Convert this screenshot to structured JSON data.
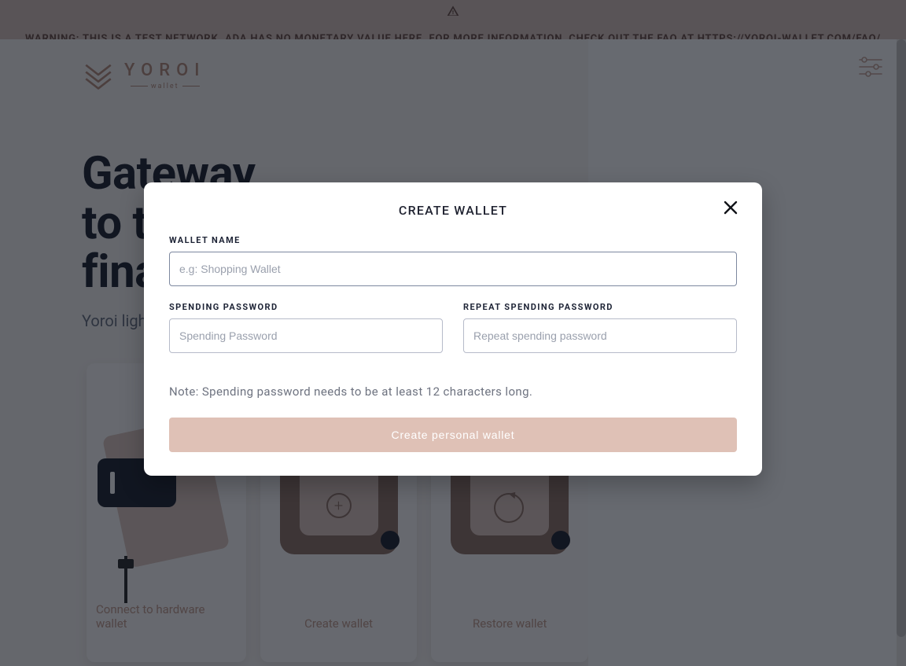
{
  "banner": {
    "text_prefix": "WARNING: THIS IS A TEST NETWORK. ADA HAS NO MONETARY VALUE HERE. FOR MORE INFORMATION, CHECK OUT THE FAQ AT ",
    "link_text": "HTTPS://YOROI-WALLET.COM/FAQ/"
  },
  "logo": {
    "name": "YOROI",
    "sub": "wallet"
  },
  "hero": {
    "title": "Gateway\nto the\nfinancial world",
    "subtitle": "Yoroi light wallet for Cardano assets"
  },
  "cards": [
    {
      "label": "Connect to hardware wallet"
    },
    {
      "label": "Create wallet"
    },
    {
      "label": "Restore wallet"
    }
  ],
  "modal": {
    "title": "CREATE WALLET",
    "wallet_name_label": "WALLET NAME",
    "wallet_name_placeholder": "e.g: Shopping Wallet",
    "wallet_name_value": "",
    "spending_pw_label": "SPENDING PASSWORD",
    "spending_pw_placeholder": "Spending Password",
    "repeat_pw_label": "REPEAT SPENDING PASSWORD",
    "repeat_pw_placeholder": "Repeat spending password",
    "note": "Note: Spending password needs to be at least 12 characters long.",
    "submit_label": "Create personal wallet"
  },
  "colors": {
    "accent": "#dfc1b6",
    "banner_bg": "#dbc6bd",
    "banner_fg": "#6a4e44"
  }
}
